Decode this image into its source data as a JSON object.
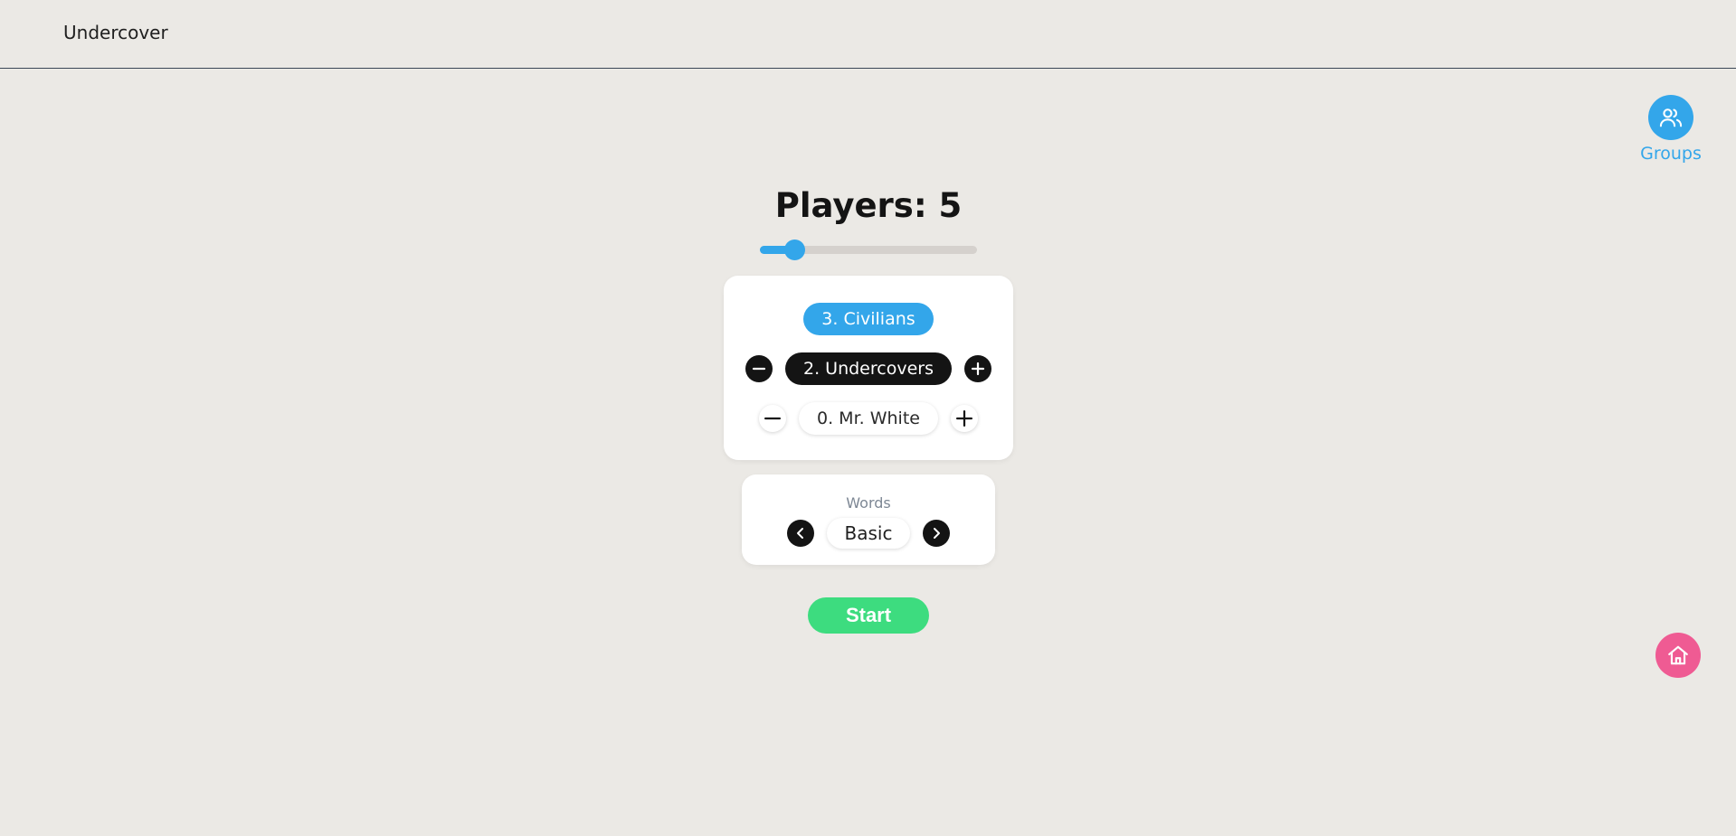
{
  "header": {
    "title": "Undercover"
  },
  "groups": {
    "label": "Groups",
    "icon": "users-icon"
  },
  "home": {
    "icon": "home-icon"
  },
  "players": {
    "title": "Players: 5",
    "count": 5,
    "min": 3,
    "max": 20
  },
  "roles": {
    "civilians": "3. Civilians",
    "undercovers": "2. Undercovers",
    "mrwhite": "0. Mr. White"
  },
  "words": {
    "label": "Words",
    "value": "Basic"
  },
  "start": {
    "label": "Start"
  },
  "colors": {
    "accent": "#33a6ea",
    "start": "#3ddc7f",
    "home": "#ef5b93",
    "background": "#ebe9e5"
  }
}
